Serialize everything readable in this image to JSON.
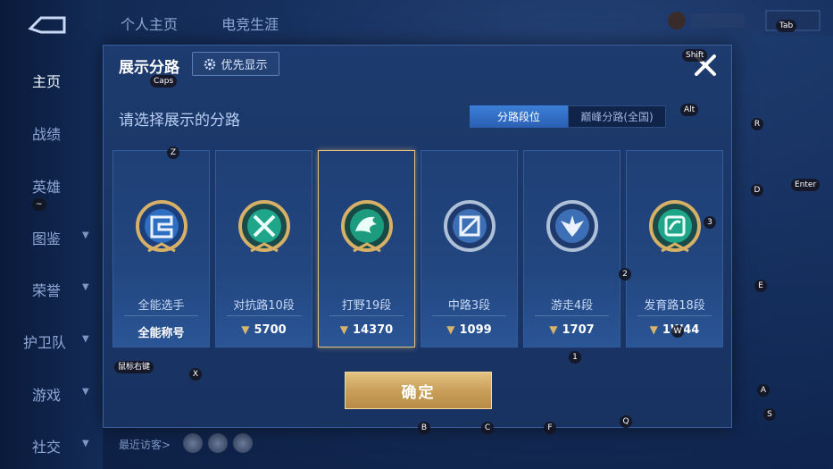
{
  "nav": {
    "top_tabs": [
      "个人主页",
      "电竞生涯"
    ],
    "items": [
      "主页",
      "战绩",
      "英雄",
      "图鉴",
      "荣誉",
      "护卫队",
      "游戏",
      "社交"
    ]
  },
  "bottom": {
    "recent_visitors": "最近访客>"
  },
  "modal": {
    "title": "展示分路",
    "priority_label": "优先显示",
    "subtitle": "请选择展示的分路",
    "segment": [
      "分路段位",
      "巅峰分路(全国)"
    ],
    "confirm_label": "确定",
    "cards": [
      {
        "name": "全能选手",
        "score": "全能称号",
        "emblem": "all-round-emblem-icon"
      },
      {
        "name": "对抗路10段",
        "score": "5700",
        "emblem": "clash-lane-emblem-icon"
      },
      {
        "name": "打野19段",
        "score": "14370",
        "emblem": "jungle-emblem-icon"
      },
      {
        "name": "中路3段",
        "score": "1099",
        "emblem": "mid-lane-emblem-icon"
      },
      {
        "name": "游走4段",
        "score": "1707",
        "emblem": "roam-emblem-icon"
      },
      {
        "name": "发育路18段",
        "score": "1W44",
        "emblem": "farm-lane-emblem-icon"
      }
    ]
  },
  "keys": {
    "caps": "Caps",
    "shift": "Shift",
    "tab": "Tab",
    "alt": "Alt",
    "enter": "Enter",
    "mouse_right": "鼠标右键",
    "z": "Z",
    "x": "X",
    "r": "R",
    "d": "D",
    "e": "E",
    "a": "A",
    "s": "S",
    "b": "B",
    "c": "C",
    "f": "F",
    "q": "Q",
    "w": "W",
    "one": "1",
    "two": "2",
    "three": "3",
    "tilde": "~"
  },
  "colors": {
    "accent_gold": "#e7c27a",
    "segment_active": "#3c7fd8",
    "bg_dark": "#0c1d40"
  }
}
